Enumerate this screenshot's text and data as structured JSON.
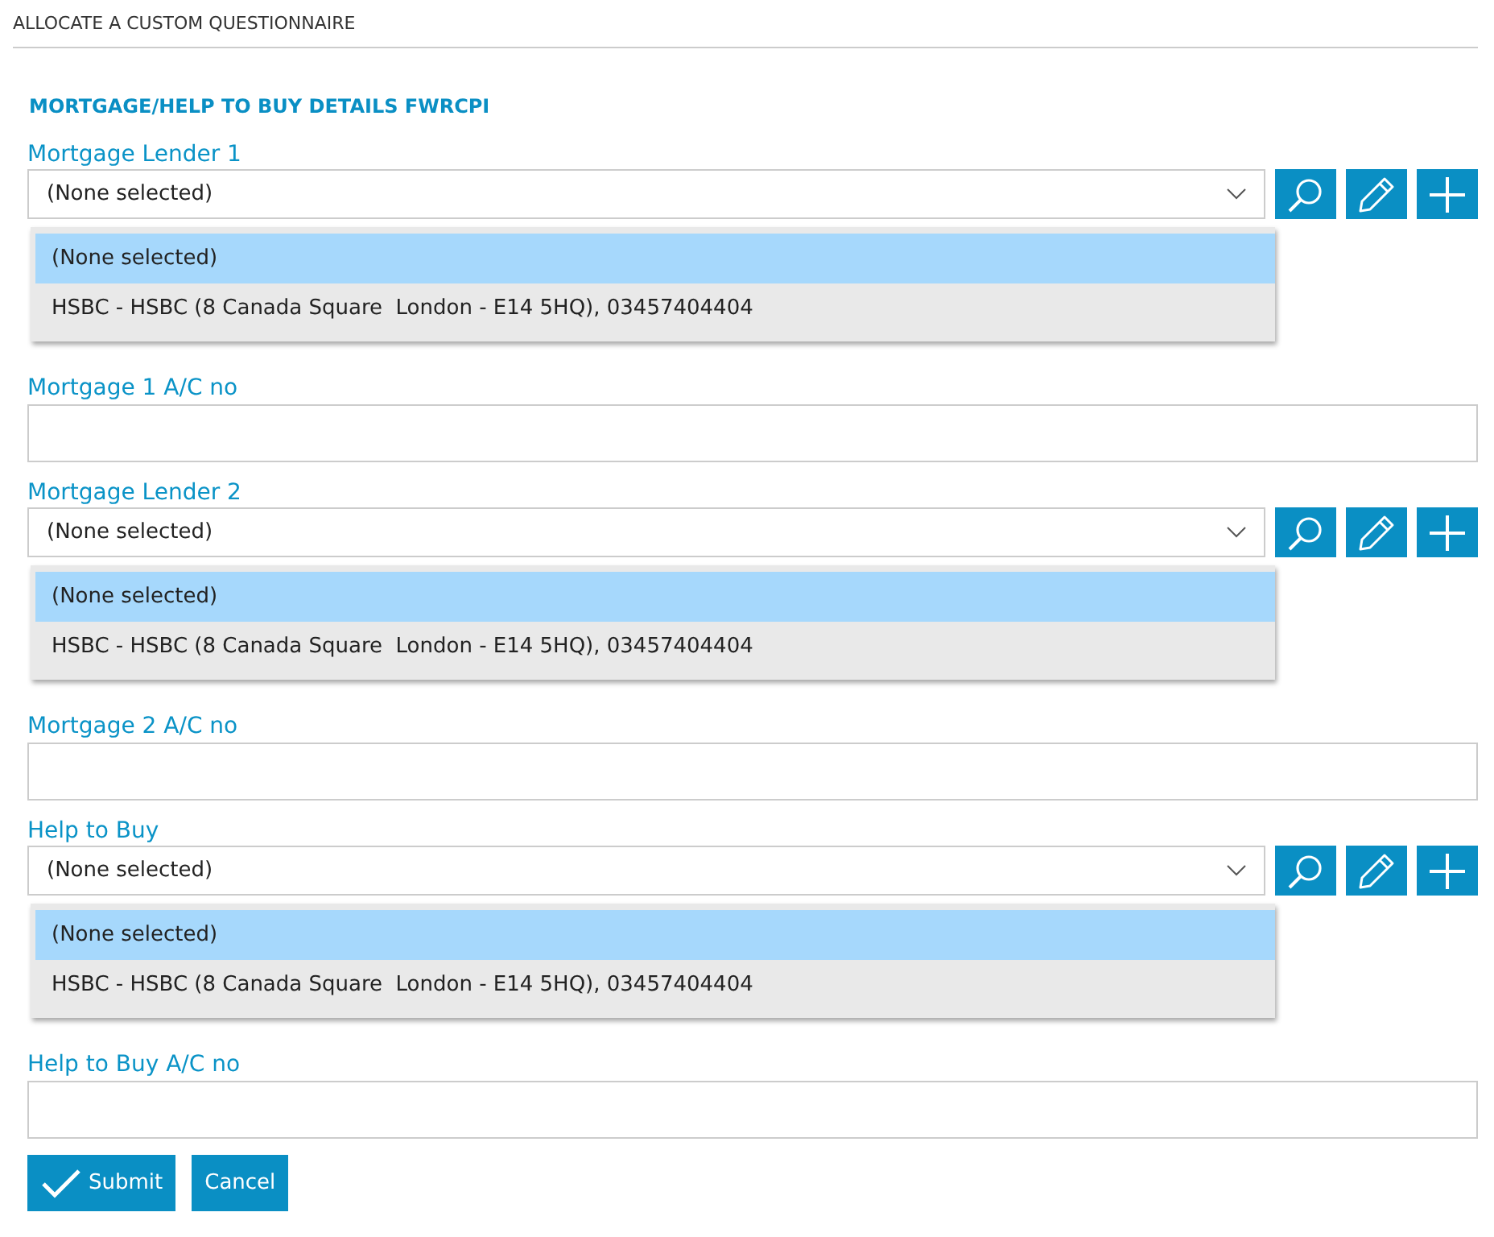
{
  "window": {
    "title": "ALLOCATE A CUSTOM QUESTIONNAIRE"
  },
  "section": {
    "heading": "MORTGAGE/HELP TO BUY DETAILS FWRCPI"
  },
  "fields": [
    {
      "kind": "select",
      "label": "Mortgage Lender 1",
      "value": "(None selected)",
      "options": [
        {
          "text": "(None selected)",
          "selected": true
        },
        {
          "text": "HSBC - HSBC (8 Canada Square  London - E14 5HQ), 03457404404",
          "selected": false
        }
      ]
    },
    {
      "kind": "input",
      "label": "Mortgage 1 A/C no"
    },
    {
      "kind": "select",
      "label": "Mortgage Lender 2",
      "value": "(None selected)",
      "options": [
        {
          "text": "(None selected)",
          "selected": true
        },
        {
          "text": "HSBC - HSBC (8 Canada Square  London - E14 5HQ), 03457404404",
          "selected": false
        }
      ]
    },
    {
      "kind": "input",
      "label": "Mortgage 2 A/C no"
    },
    {
      "kind": "select",
      "label": "Help to Buy",
      "value": "(None selected)",
      "options": [
        {
          "text": "(None selected)",
          "selected": true
        },
        {
          "text": "HSBC - HSBC (8 Canada Square  London - E14 5HQ), 03457404404",
          "selected": false
        }
      ]
    },
    {
      "kind": "input",
      "label": "Help to Buy A/C no"
    }
  ],
  "buttons": [
    {
      "kind": "submit",
      "label": "Submit"
    },
    {
      "kind": "cancel",
      "label": "Cancel"
    }
  ]
}
